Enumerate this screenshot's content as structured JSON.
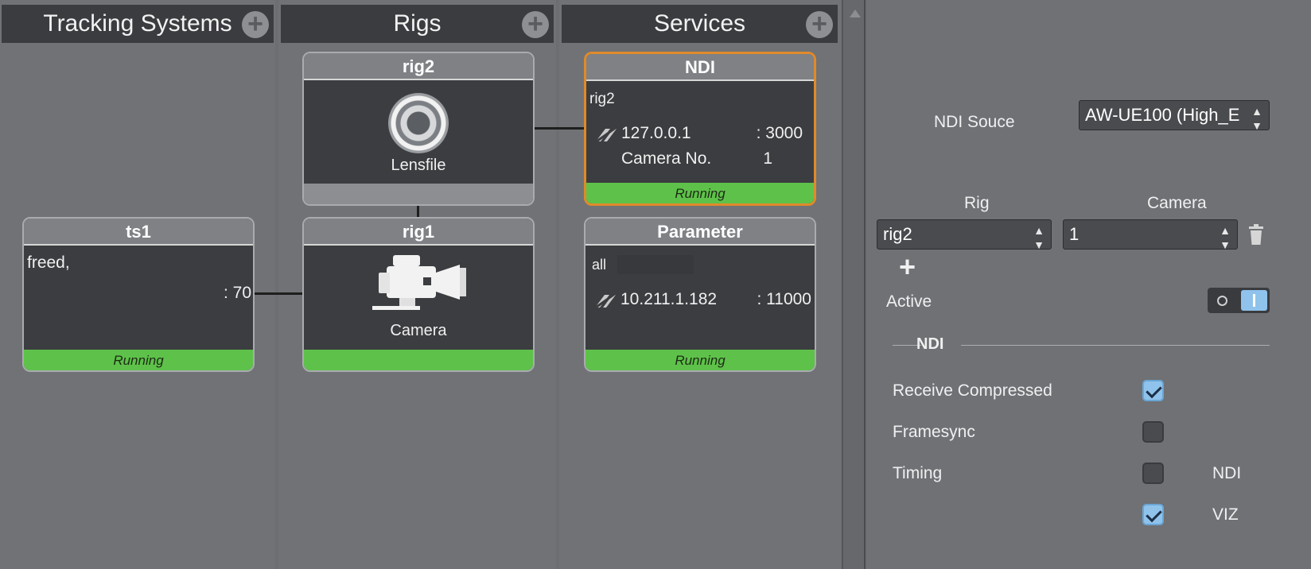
{
  "columns": {
    "tracking": {
      "title": "Tracking Systems",
      "add": "+"
    },
    "rigs": {
      "title": "Rigs",
      "add": "+"
    },
    "services": {
      "title": "Services",
      "add": "+"
    }
  },
  "tracking_cards": [
    {
      "title": "ts1",
      "line1": "freed,",
      "line2": ": 70",
      "status": "Running"
    }
  ],
  "rig_cards": [
    {
      "title": "rig2",
      "icon_label": "Lensfile",
      "icon": "lens-icon",
      "status": ""
    },
    {
      "title": "rig1",
      "icon_label": "Camera",
      "icon": "camera-icon",
      "status": ""
    }
  ],
  "service_cards": [
    {
      "title": "NDI",
      "rig": "rig2",
      "ip": "127.0.0.1",
      "port": ": 3000",
      "camera_label": "Camera No.",
      "camera_value": "1",
      "status": "Running"
    },
    {
      "title": "Parameter",
      "rig": "all",
      "ip": "10.211.1.182",
      "port": ": 11000",
      "status": "Running"
    }
  ],
  "panel": {
    "ndi_source_label": "NDI Souce",
    "ndi_source_value": "AW-UE100 (High_E",
    "rig_label": "Rig",
    "camera_label": "Camera",
    "rig_value": "rig2",
    "camera_value": "1",
    "add": "+",
    "active_label": "Active",
    "section_title": "NDI",
    "receive_compressed_label": "Receive Compressed",
    "framesync_label": "Framesync",
    "timing_label": "Timing",
    "timing_ndi_label": "NDI",
    "timing_viz_label": "VIZ",
    "receive_compressed": true,
    "framesync": false,
    "timing_ndi": false,
    "timing_viz": true
  },
  "colors": {
    "running": "#5ec24a",
    "selected_border": "#e08a2a",
    "checkbox_on": "#8fc3ec"
  }
}
